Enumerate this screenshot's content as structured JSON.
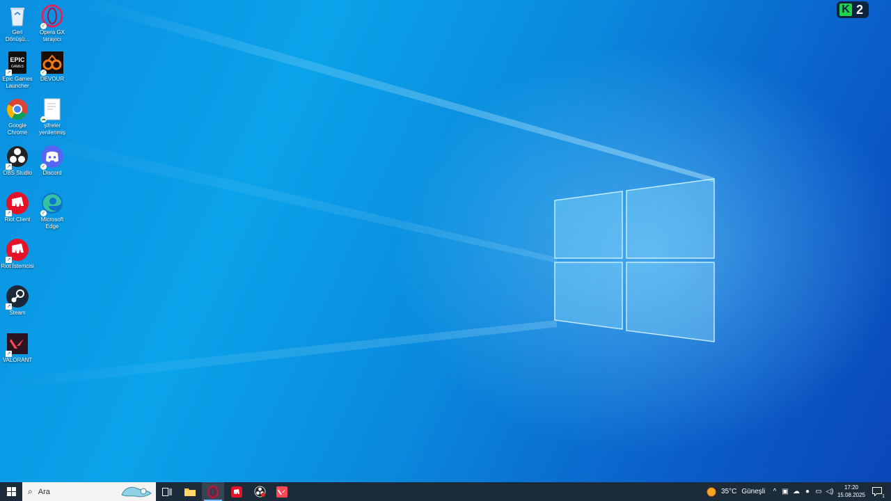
{
  "desktop_icons": [
    {
      "label": "Geri Dönüşü...",
      "icon": "recycle-bin-icon"
    },
    {
      "label": "Opera GX tarayıcı",
      "icon": "opera-gx-icon"
    },
    {
      "label": "Epic Games Launcher",
      "icon": "epic-games-icon"
    },
    {
      "label": "DEVOUR",
      "icon": "devour-icon"
    },
    {
      "label": "Google Chrome",
      "icon": "chrome-icon"
    },
    {
      "label": "şifreler yenilenmiş",
      "icon": "document-icon"
    },
    {
      "label": "OBS Studio",
      "icon": "obs-icon"
    },
    {
      "label": "Discord",
      "icon": "discord-icon"
    },
    {
      "label": "Riot Client",
      "icon": "riot-client-icon"
    },
    {
      "label": "Microsoft Edge",
      "icon": "edge-icon"
    },
    {
      "label": "Riot İstemcisi",
      "icon": "riot-client-icon"
    },
    {
      "label": "Steam",
      "icon": "steam-icon"
    },
    {
      "label": "VALORANT",
      "icon": "valorant-icon"
    }
  ],
  "overlay_badge": {
    "letter": "K",
    "count": "2"
  },
  "taskbar": {
    "search_placeholder": "Ara",
    "weather": {
      "temp": "35°C",
      "condition": "Güneşli"
    },
    "clock": {
      "time": "17:20",
      "date": "15.08.2025"
    },
    "notification_count": "1",
    "colors": {
      "taskbar": "#1c2b3a",
      "search_bg": "#f3f3f3"
    }
  }
}
